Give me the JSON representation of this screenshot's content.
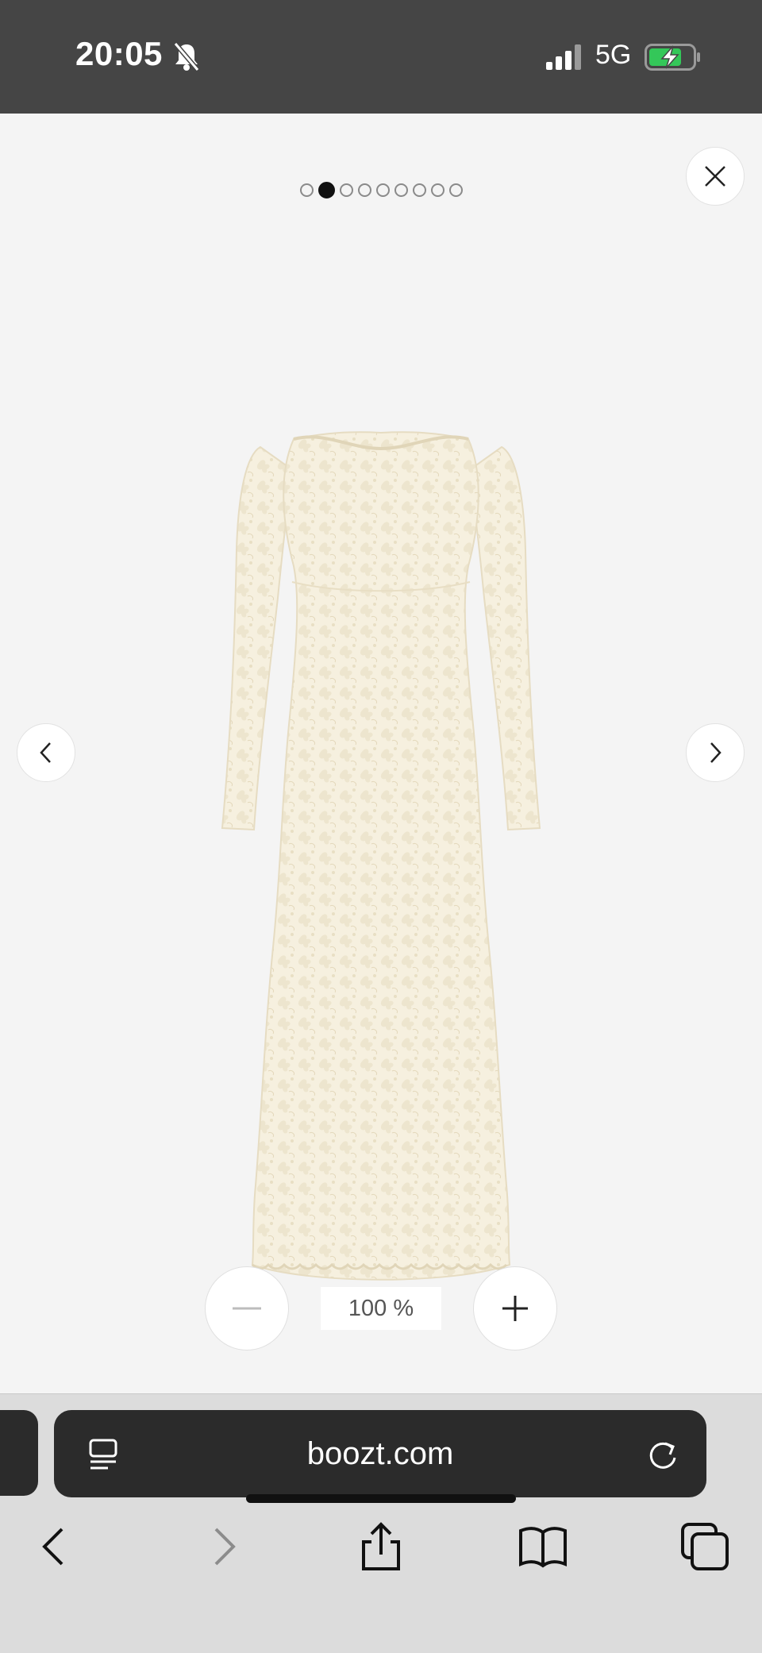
{
  "status": {
    "time": "20:05",
    "network": "5G",
    "icons": [
      "bell-slash-icon",
      "signal-icon",
      "battery-charging-icon"
    ]
  },
  "gallery": {
    "total_images": 9,
    "active_index": 1,
    "icons": {
      "close": "close-icon",
      "prev": "chevron-left-icon",
      "next": "chevron-right-icon"
    },
    "product_image": "cream-lace-long-sleeve-maxi-dress"
  },
  "zoom": {
    "level": "100 %",
    "icons": [
      "minus-icon",
      "plus-icon"
    ]
  },
  "browser": {
    "url": "boozt.com",
    "icons": [
      "reader-icon",
      "reload-icon",
      "back-icon",
      "forward-icon",
      "share-icon",
      "bookmarks-icon",
      "tabs-icon"
    ]
  },
  "colors": {
    "status_bar": "#454545",
    "viewer_bg": "#f4f4f4",
    "url_bar": "#2b2b2b",
    "battery_green": "#34c759",
    "dress": "#f5efde"
  }
}
